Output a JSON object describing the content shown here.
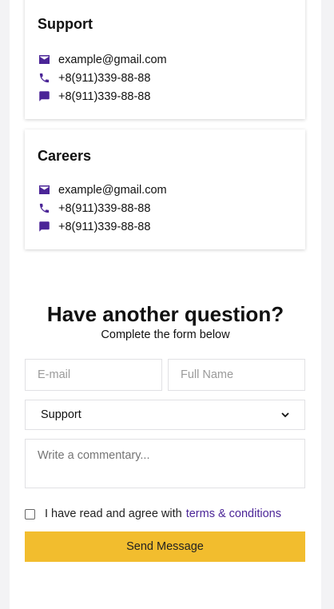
{
  "cards": [
    {
      "title": "Support",
      "email": "example@gmail.com",
      "phone": "+8(911)339-88-88",
      "chat": "+8(911)339-88-88"
    },
    {
      "title": "Careers",
      "email": "example@gmail.com",
      "phone": "+8(911)339-88-88",
      "chat": "+8(911)339-88-88"
    }
  ],
  "form": {
    "title": "Have another question?",
    "subtitle": "Complete the form below",
    "email_placeholder": "E-mail",
    "name_placeholder": "Full Name",
    "department_value": "Support",
    "comment_placeholder": "Write a commentary...",
    "agree_text": "I have read and agree with",
    "terms_link": "terms & conditions",
    "send_label": "Send Message"
  },
  "colors": {
    "accent": "#4b2597",
    "button": "#f2bd2e"
  }
}
